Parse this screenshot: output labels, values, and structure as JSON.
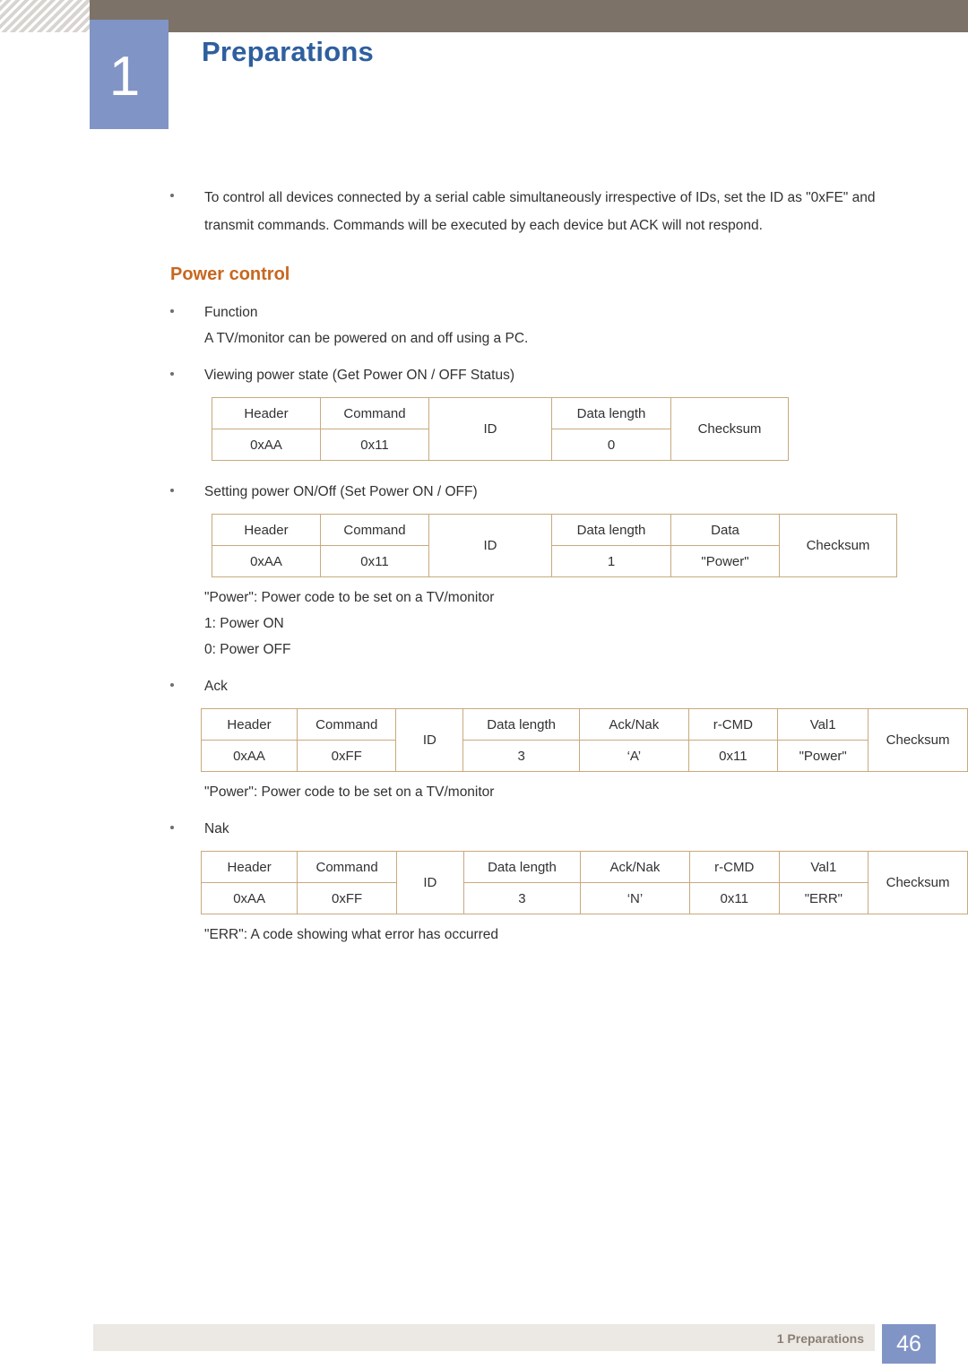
{
  "header": {
    "chapter_number": "1",
    "title": "Preparations"
  },
  "intro": {
    "bullet_text": "To control all devices connected by a serial cable simultaneously irrespective of IDs, set the ID as \"0xFE\" and transmit commands. Commands will be executed by each device but ACK will not respond."
  },
  "section": {
    "heading": "Power control"
  },
  "items": {
    "function_label": "Function",
    "function_desc": "A TV/monitor can be powered on and off using a PC.",
    "view_label": "Viewing power state (Get Power ON / OFF Status)",
    "set_label": "Setting power ON/Off (Set Power ON / OFF)",
    "power_note": "\"Power\": Power code to be set on a TV/monitor",
    "power_on": "1: Power ON",
    "power_off": "0: Power OFF",
    "ack_label": "Ack",
    "ack_note": "\"Power\": Power code to be set on a TV/monitor",
    "nak_label": "Nak",
    "nak_note": "\"ERR\": A code showing what error has occurred"
  },
  "tables": {
    "get_status": {
      "headers": [
        "Header",
        "Command",
        "ID",
        "Data length",
        "Checksum"
      ],
      "values": [
        "0xAA",
        "0x11",
        "0"
      ]
    },
    "set_power": {
      "headers": [
        "Header",
        "Command",
        "ID",
        "Data length",
        "Data",
        "Checksum"
      ],
      "values": [
        "0xAA",
        "0x11",
        "1",
        "\"Power\""
      ]
    },
    "ack": {
      "headers": [
        "Header",
        "Command",
        "ID",
        "Data length",
        "Ack/Nak",
        "r-CMD",
        "Val1",
        "Checksum"
      ],
      "values": [
        "0xAA",
        "0xFF",
        "3",
        "‘A’",
        "0x11",
        "\"Power\""
      ]
    },
    "nak": {
      "headers": [
        "Header",
        "Command",
        "ID",
        "Data length",
        "Ack/Nak",
        "r-CMD",
        "Val1",
        "Checksum"
      ],
      "values": [
        "0xAA",
        "0xFF",
        "3",
        "‘N’",
        "0x11",
        "\"ERR\""
      ]
    }
  },
  "footer": {
    "label": "1 Preparations",
    "page_number": "46"
  }
}
